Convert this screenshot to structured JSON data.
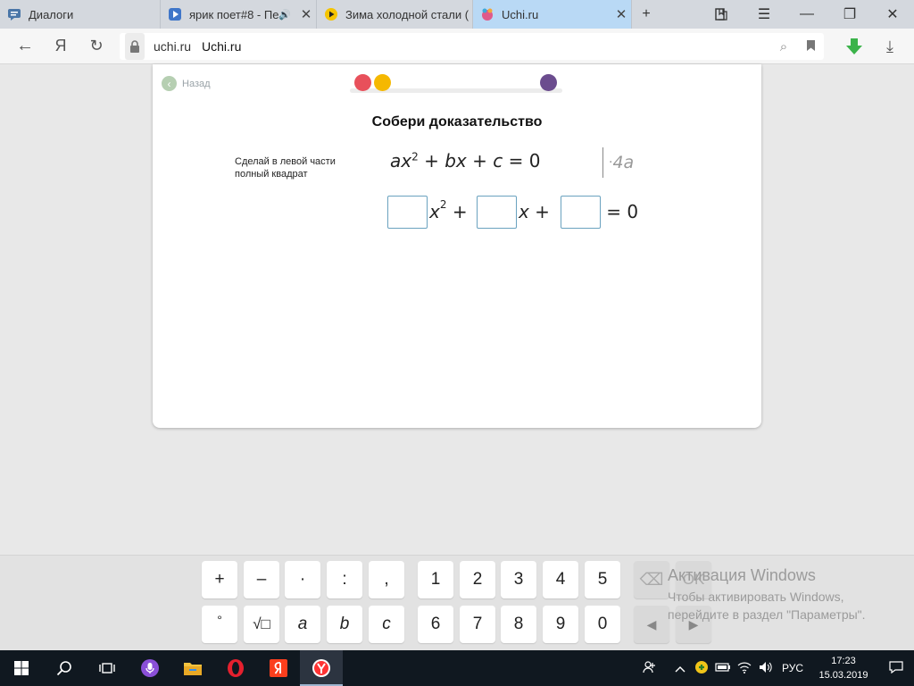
{
  "browser": {
    "tabs": [
      {
        "title": "Диалоги",
        "icon": "chat-icon"
      },
      {
        "title": "ярик поет#8 - Пе",
        "icon": "video-icon",
        "sound": "🔊"
      },
      {
        "title": "Зима холодной стали (",
        "icon": "play-icon"
      },
      {
        "title": "Uchi.ru",
        "icon": "uchi-icon",
        "active": true
      }
    ],
    "address": {
      "domain": "uchi.ru",
      "page_title": "Uchi.ru"
    }
  },
  "page": {
    "back_label": "Назад",
    "progress": {
      "colors": [
        "#e8505b",
        "#f5b800",
        "#6b4c8e"
      ]
    },
    "title": "Собери доказательство",
    "instruction_line1": "Сделай в левой части",
    "instruction_line2": "полный квадрат",
    "formula": {
      "a": "ax",
      "sup": "2",
      "plus1": " + ",
      "b": "bx",
      "plus2": " + ",
      "c": "c",
      "rhs": " = 0"
    },
    "multiplier": {
      "dot": "· ",
      "value": "4a"
    },
    "equation": {
      "x": "x",
      "sup": "2",
      "plus": " + ",
      "x2": "x",
      "plus2": " + ",
      "rhs": "= 0"
    }
  },
  "keyboard": {
    "row1": [
      "+",
      "–",
      "·",
      ":",
      ",",
      "1",
      "2",
      "3",
      "4",
      "5"
    ],
    "row2": [
      "°",
      "√□",
      "a",
      "b",
      "c",
      "6",
      "7",
      "8",
      "9",
      "0"
    ],
    "backspace": "⌫",
    "ok": "OK",
    "left": "◀",
    "right": "▶"
  },
  "watermark": {
    "title": "Активация Windows",
    "line1": "Чтобы активировать Windows,",
    "line2": "перейдите в раздел \"Параметры\"."
  },
  "taskbar": {
    "language": "РУС",
    "time": "17:23",
    "date": "15.03.2019"
  }
}
